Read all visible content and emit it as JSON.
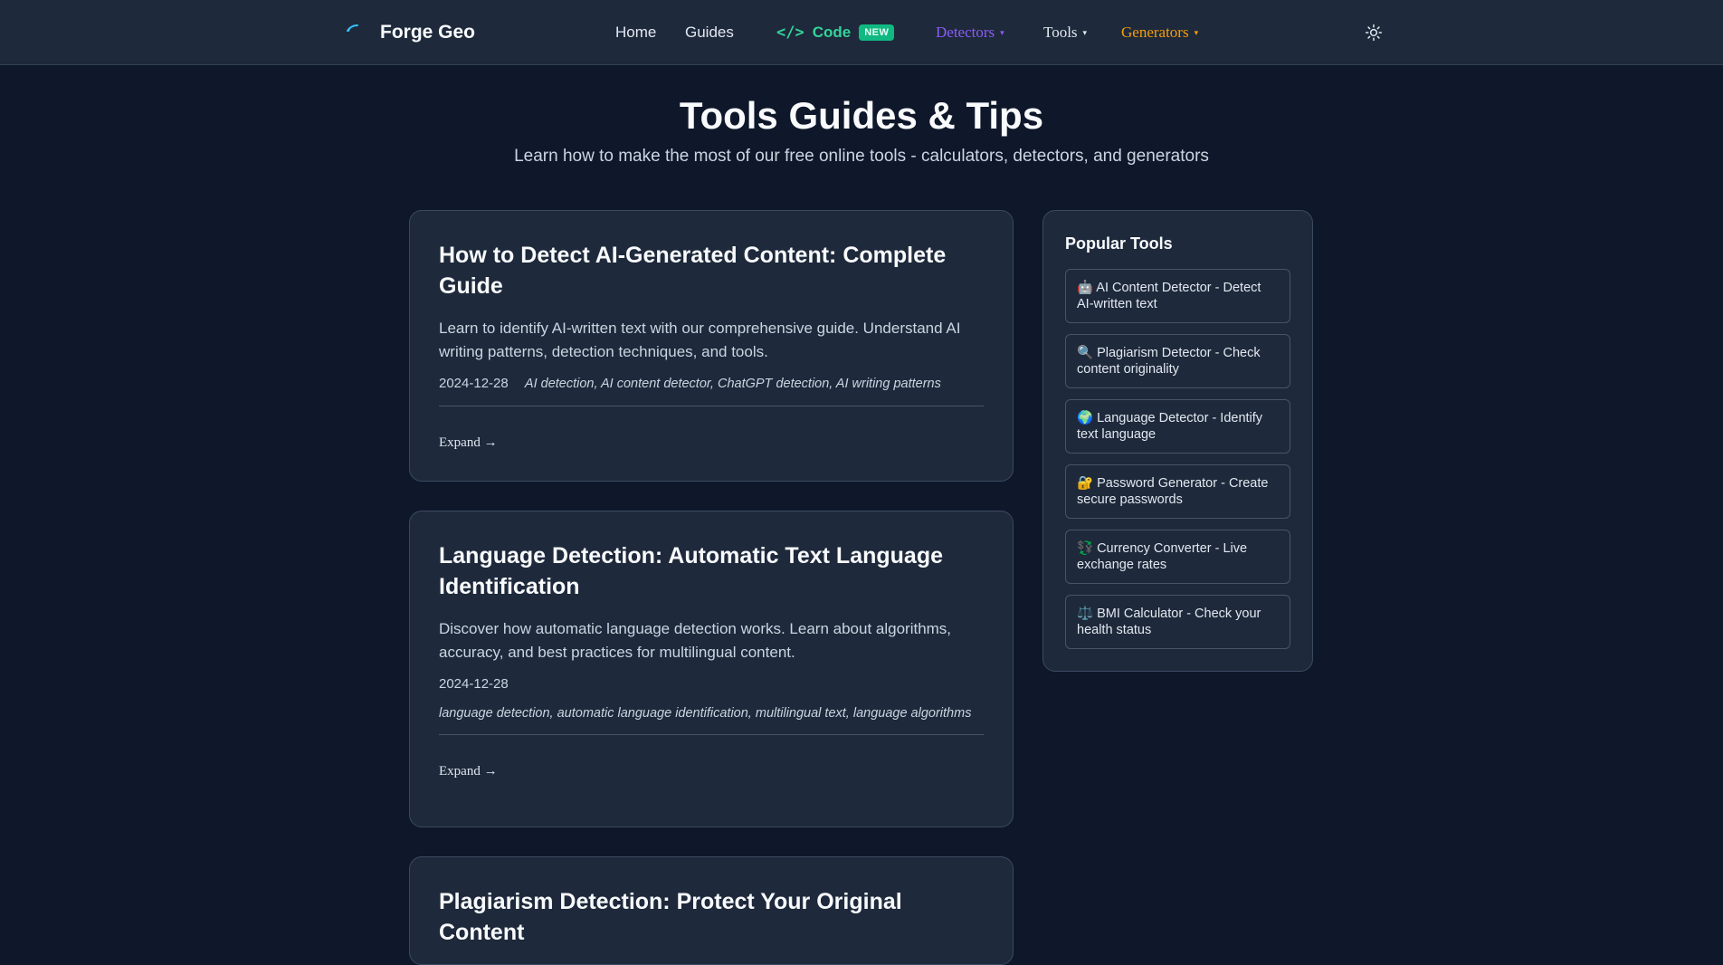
{
  "header": {
    "brand": "Forge Geo",
    "nav": {
      "home": "Home",
      "guides": "Guides",
      "code_glyph": "</>",
      "code": "Code",
      "code_badge": "NEW",
      "detectors": "Detectors",
      "tools": "Tools",
      "generators": "Generators",
      "caret": "▾"
    },
    "colors": {
      "detectors": "#8b5cf6",
      "tools": "#e2e8f0",
      "generators": "#f59e0b",
      "code": "#34d399"
    }
  },
  "hero": {
    "title": "Tools Guides & Tips",
    "subtitle": "Learn how to make the most of our free online tools - calculators, detectors, and generators"
  },
  "articles": [
    {
      "title": "How to Detect AI-Generated Content: Complete Guide",
      "description": "Learn to identify AI-written text with our comprehensive guide. Understand AI writing patterns, detection techniques, and tools.",
      "date": "2024-12-28",
      "tags": "AI detection, AI content detector, ChatGPT detection, AI writing patterns",
      "expand": "Expand →"
    },
    {
      "title": "Language Detection: Automatic Text Language Identification",
      "description": "Discover how automatic language detection works. Learn about algorithms, accuracy, and best practices for multilingual content.",
      "date": "2024-12-28",
      "tags": "language detection, automatic language identification, multilingual text, language algorithms",
      "expand": "Expand →"
    },
    {
      "title": "Plagiarism Detection: Protect Your Original Content"
    }
  ],
  "sidebar": {
    "title": "Popular Tools",
    "items": [
      {
        "label": "🤖 AI Content Detector - Detect AI-written text"
      },
      {
        "label": "🔍 Plagiarism Detector - Check content originality"
      },
      {
        "label": "🌍 Language Detector - Identify text language"
      },
      {
        "label": "🔐 Password Generator - Create secure passwords"
      },
      {
        "label": "💱 Currency Converter - Live exchange rates"
      },
      {
        "label": "⚖️ BMI Calculator - Check your health status"
      }
    ]
  },
  "icons": {
    "logo": "forge-logo-icon",
    "theme": "sun-icon"
  }
}
